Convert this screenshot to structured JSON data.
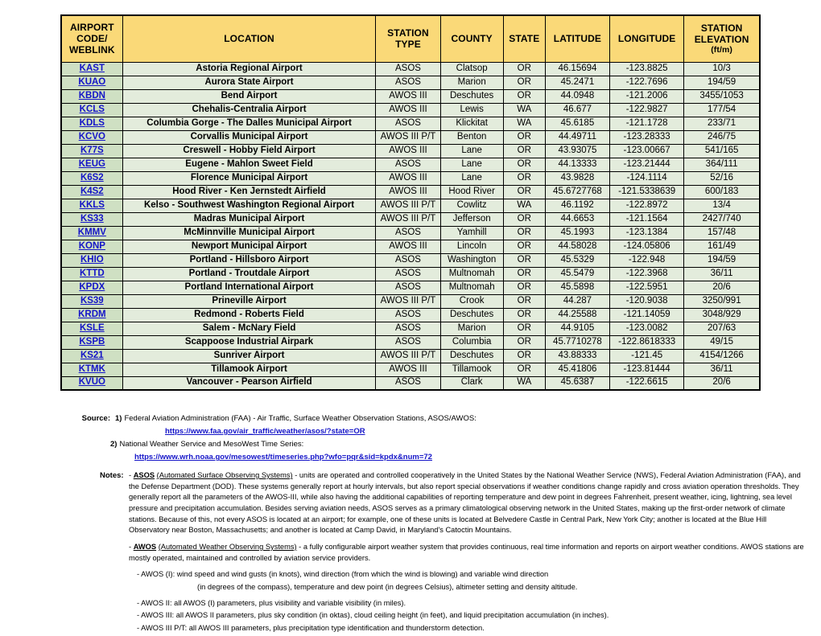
{
  "table": {
    "headers": [
      {
        "line1": "AIRPORT",
        "line2": "CODE/",
        "line3": "WEBLINK"
      },
      {
        "line1": "LOCATION"
      },
      {
        "line1": "STATION",
        "line2": "TYPE"
      },
      {
        "line1": "COUNTY"
      },
      {
        "line1": "STATE"
      },
      {
        "line1": "LATITUDE"
      },
      {
        "line1": "LONGITUDE"
      },
      {
        "line1": "STATION",
        "line2": "ELEVATION",
        "sub": "(ft/m)"
      }
    ],
    "rows": [
      {
        "code": "KAST",
        "location": "Astoria Regional Airport",
        "type": "ASOS",
        "county": "Clatsop",
        "state": "OR",
        "lat": "46.15694",
        "lon": "-123.8825",
        "elev": "10/3"
      },
      {
        "code": "KUAO",
        "location": "Aurora State Airport",
        "type": "ASOS",
        "county": "Marion",
        "state": "OR",
        "lat": "45.2471",
        "lon": "-122.7696",
        "elev": "194/59"
      },
      {
        "code": "KBDN",
        "location": "Bend Airport",
        "type": "AWOS III",
        "county": "Deschutes",
        "state": "OR",
        "lat": "44.0948",
        "lon": "-121.2006",
        "elev": "3455/1053"
      },
      {
        "code": "KCLS",
        "location": "Chehalis-Centralia Airport",
        "type": "AWOS III",
        "county": "Lewis",
        "state": "WA",
        "lat": "46.677",
        "lon": "-122.9827",
        "elev": "177/54"
      },
      {
        "code": "KDLS",
        "location": "Columbia Gorge - The Dalles Municipal Airport",
        "type": "ASOS",
        "county": "Klickitat",
        "state": "WA",
        "lat": "45.6185",
        "lon": "-121.1728",
        "elev": "233/71"
      },
      {
        "code": "KCVO",
        "location": "Corvallis Municipal Airport",
        "type": "AWOS III P/T",
        "county": "Benton",
        "state": "OR",
        "lat": "44.49711",
        "lon": "-123.28333",
        "elev": "246/75"
      },
      {
        "code": "K77S",
        "location": "Creswell - Hobby Field Airport",
        "type": "AWOS III",
        "county": "Lane",
        "state": "OR",
        "lat": "43.93075",
        "lon": "-123.00667",
        "elev": "541/165"
      },
      {
        "code": "KEUG",
        "location": "Eugene - Mahlon Sweet Field",
        "type": "ASOS",
        "county": "Lane",
        "state": "OR",
        "lat": "44.13333",
        "lon": "-123.21444",
        "elev": "364/111"
      },
      {
        "code": "K6S2",
        "location": "Florence Municipal Airport",
        "type": "AWOS III",
        "county": "Lane",
        "state": "OR",
        "lat": "43.9828",
        "lon": "-124.1114",
        "elev": "52/16"
      },
      {
        "code": "K4S2",
        "location": "Hood River - Ken Jernstedt Airfield",
        "type": "AWOS III",
        "county": "Hood River",
        "state": "OR",
        "lat": "45.6727768",
        "lon": "-121.5338639",
        "elev": "600/183"
      },
      {
        "code": "KKLS",
        "location": "Kelso - Southwest Washington Regional Airport",
        "type": "AWOS III P/T",
        "county": "Cowlitz",
        "state": "WA",
        "lat": "46.1192",
        "lon": "-122.8972",
        "elev": "13/4"
      },
      {
        "code": "KS33",
        "location": "Madras Municipal Airport",
        "type": "AWOS III P/T",
        "county": "Jefferson",
        "state": "OR",
        "lat": "44.6653",
        "lon": "-121.1564",
        "elev": "2427/740"
      },
      {
        "code": "KMMV",
        "location": "McMinnville Municipal Airport",
        "type": "ASOS",
        "county": "Yamhill",
        "state": "OR",
        "lat": "45.1993",
        "lon": "-123.1384",
        "elev": "157/48"
      },
      {
        "code": "KONP",
        "location": "Newport Municipal Airport",
        "type": "AWOS III",
        "county": "Lincoln",
        "state": "OR",
        "lat": "44.58028",
        "lon": "-124.05806",
        "elev": "161/49"
      },
      {
        "code": "KHIO",
        "location": "Portland - Hillsboro Airport",
        "type": "ASOS",
        "county": "Washington",
        "state": "OR",
        "lat": "45.5329",
        "lon": "-122.948",
        "elev": "194/59"
      },
      {
        "code": "KTTD",
        "location": "Portland - Troutdale Airport",
        "type": "ASOS",
        "county": "Multnomah",
        "state": "OR",
        "lat": "45.5479",
        "lon": "-122.3968",
        "elev": "36/11"
      },
      {
        "code": "KPDX",
        "location": "Portland International Airport",
        "type": "ASOS",
        "county": "Multnomah",
        "state": "OR",
        "lat": "45.5898",
        "lon": "-122.5951",
        "elev": "20/6"
      },
      {
        "code": "KS39",
        "location": "Prineville Airport",
        "type": "AWOS III P/T",
        "county": "Crook",
        "state": "OR",
        "lat": "44.287",
        "lon": "-120.9038",
        "elev": "3250/991"
      },
      {
        "code": "KRDM",
        "location": "Redmond - Roberts Field",
        "type": "ASOS",
        "county": "Deschutes",
        "state": "OR",
        "lat": "44.25588",
        "lon": "-121.14059",
        "elev": "3048/929"
      },
      {
        "code": "KSLE",
        "location": "Salem - McNary Field",
        "type": "ASOS",
        "county": "Marion",
        "state": "OR",
        "lat": "44.9105",
        "lon": "-123.0082",
        "elev": "207/63"
      },
      {
        "code": "KSPB",
        "location": "Scappoose Industrial Airpark",
        "type": "ASOS",
        "county": "Columbia",
        "state": "OR",
        "lat": "45.7710278",
        "lon": "-122.8618333",
        "elev": "49/15"
      },
      {
        "code": "KS21",
        "location": "Sunriver Airport",
        "type": "AWOS III P/T",
        "county": "Deschutes",
        "state": "OR",
        "lat": "43.88333",
        "lon": "-121.45",
        "elev": "4154/1266"
      },
      {
        "code": "KTMK",
        "location": "Tillamook Airport",
        "type": "AWOS III",
        "county": "Tillamook",
        "state": "OR",
        "lat": "45.41806",
        "lon": "-123.81444",
        "elev": "36/11"
      },
      {
        "code": "KVUO",
        "location": "Vancouver - Pearson Airfield",
        "type": "ASOS",
        "county": "Clark",
        "state": "WA",
        "lat": "45.6387",
        "lon": "-122.6615",
        "elev": "20/6"
      }
    ]
  },
  "source": {
    "label": "Source:",
    "item1_num": "1)",
    "item1_text": "Federal Aviation Administration (FAA)  - Air Traffic, Surface Weather Observation Stations, ASOS/AWOS:",
    "item1_link": "https://www.faa.gov/air_traffic/weather/asos/?state=OR",
    "item2_num": "2)",
    "item2_text": "National Weather Service and MesoWest Time Series:",
    "item2_link": "https://www.wrh.noaa.gov/mesowest/timeseries.php?wfo=pqr&sid=kpdx&num=72"
  },
  "notes": {
    "label": "Notes:",
    "asos_dash": "- ",
    "asos_term": "ASOS",
    "asos_paren": "(Automated Surface Observing Systems)",
    "asos_body": " - units are operated and controlled cooperatively in the United States by the National Weather Service (NWS), Federal Aviation Administration (FAA), and the Defense Department (DOD). These systems generally report at hourly intervals, but also report special observations if weather conditions change rapidly and cross aviation operation thresholds. They generally report all the parameters of the AWOS-III, while also having the additional capabilities of reporting temperature and dew point in degrees Fahrenheit, present weather, icing, lightning, sea level pressure and precipitation accumulation. Besides serving aviation needs, ASOS serves as a primary climatological observing network in the United States, making up the first-order network of climate stations. Because of this, not every ASOS is located at an airport; for example, one of these units is located at Belvedere Castle in Central Park, New York City; another is located at the Blue Hill Observatory near Boston, Massachusetts; and another is located at Camp David, in Maryland's Catoctin Mountains.",
    "awos_dash": "- ",
    "awos_term": "AWOS",
    "awos_paren": "(Automated Weather Observing Systems)",
    "awos_body": " - a fully configurable airport weather system that provides continuous, real time information and reports on airport weather conditions. AWOS stations are mostly operated, maintained and controlled by aviation service providers.",
    "awos_1": "- AWOS (I): wind speed and wind gusts (in knots), wind direction (from which the wind is blowing) and variable wind direction",
    "awos_1b": "(in degrees of the compass), temperature and dew point (in degrees Celsius), altimeter setting and density altitude.",
    "awos_2": "- AWOS II: all AWOS (I) parameters, plus visibility and variable visibility (in miles).",
    "awos_3": "- AWOS III: all AWOS II parameters, plus sky condition (in oktas), cloud ceiling height (in feet), and liquid precipitation accumulation (in inches).",
    "awos_pt": "- AWOS III P/T: all AWOS III parameters, plus precipitation type identification and thunderstorm detection."
  },
  "colors": {
    "header_bg": "#fad978",
    "code_cell_bg": "#cfe0c3",
    "data_cell_bg": "#e3ecdc",
    "link": "#1414c8"
  }
}
